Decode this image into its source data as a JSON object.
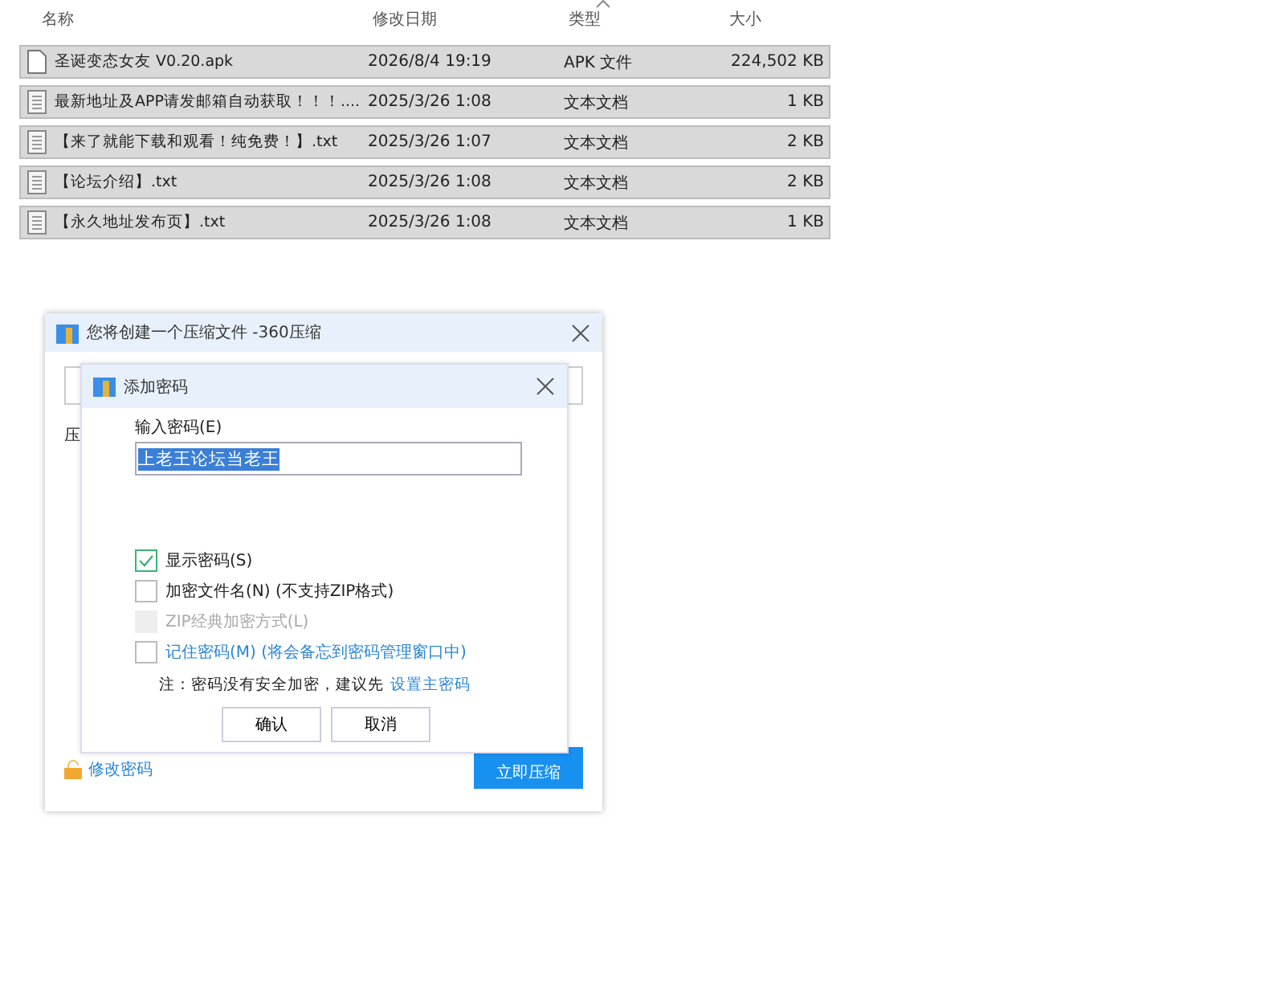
{
  "file_list": {
    "columns": [
      "名称",
      "修改日期",
      "类型",
      "大小"
    ],
    "rows": [
      {
        "name": "圣诞变态女友 V0.20.apk",
        "date": "2026/8/4 19:19",
        "type": "APK 文件",
        "size": "224,502 KB",
        "kind": "file"
      },
      {
        "name": "最新地址及APP请发邮箱自动获取！！！....",
        "date": "2025/3/26 1:08",
        "type": "文本文档",
        "size": "1 KB",
        "kind": "text"
      },
      {
        "name": "【来了就能下载和观看！纯免费！】.txt",
        "date": "2025/3/26 1:07",
        "type": "文本文档",
        "size": "2 KB",
        "kind": "text"
      },
      {
        "name": "【论坛介绍】.txt",
        "date": "2025/3/26 1:08",
        "type": "文本文档",
        "size": "2 KB",
        "kind": "text"
      },
      {
        "name": "【永久地址发布页】.txt",
        "date": "2025/3/26 1:08",
        "type": "文本文档",
        "size": "1 KB",
        "kind": "text"
      }
    ]
  },
  "compress_dialog": {
    "title": "您将创建一个压缩文件 -360压缩",
    "label": "压",
    "change_password": "修改密码",
    "compress_button": "立即压缩"
  },
  "password_dialog": {
    "title": "添加密码",
    "field_label": "输入密码(E)",
    "password": "上老王论坛当老王",
    "options": [
      {
        "label": "显示密码(S)",
        "checked": true,
        "disabled": false,
        "kind": "plain"
      },
      {
        "label": "加密文件名(N) (不支持ZIP格式)",
        "checked": false,
        "disabled": false,
        "kind": "plain"
      },
      {
        "label": "ZIP经典加密方式(L)",
        "checked": false,
        "disabled": true,
        "kind": "plain"
      },
      {
        "label": "记住密码(M) (将会备忘到密码管理窗口中)",
        "checked": false,
        "disabled": false,
        "kind": "link"
      }
    ],
    "note": "注：密码没有安全加密，建议先",
    "note_link": "设置主密码",
    "buttons": [
      "确认",
      "取消"
    ]
  }
}
